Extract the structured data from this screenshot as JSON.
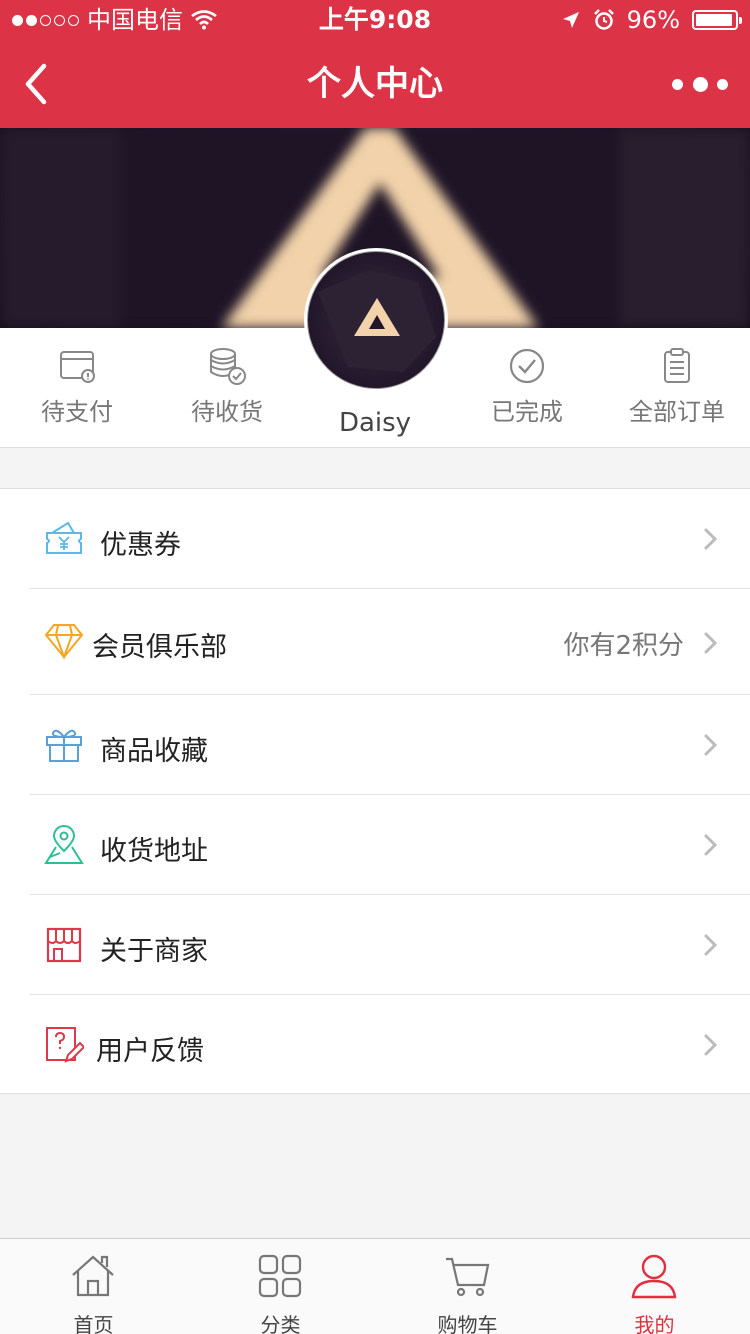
{
  "status_bar": {
    "carrier": "中国电信",
    "time": "上午9:08",
    "battery": "96%",
    "battery_level": 0.96
  },
  "nav": {
    "title": "个人中心",
    "back_icon": "chevron-left-icon",
    "more_icon": "ellipsis-icon"
  },
  "profile": {
    "username": "Daisy"
  },
  "orders": [
    {
      "label": "待支付",
      "icon": "wallet-icon"
    },
    {
      "label": "待收货",
      "icon": "coins-check-icon"
    },
    {
      "label": "已完成",
      "icon": "check-circle-icon"
    },
    {
      "label": "全部订单",
      "icon": "clipboard-icon"
    }
  ],
  "menu": [
    {
      "label": "优惠券",
      "icon": "coupon-icon",
      "extra": ""
    },
    {
      "label": "会员俱乐部",
      "icon": "diamond-icon",
      "extra": "你有2积分"
    },
    {
      "label": "商品收藏",
      "icon": "gift-icon",
      "extra": ""
    },
    {
      "label": "收货地址",
      "icon": "map-pin-icon",
      "extra": ""
    },
    {
      "label": "关于商家",
      "icon": "store-icon",
      "extra": ""
    },
    {
      "label": "用户反馈",
      "icon": "feedback-icon",
      "extra": ""
    }
  ],
  "tabbar": [
    {
      "label": "首页",
      "icon": "home-icon",
      "active": false
    },
    {
      "label": "分类",
      "icon": "grid-icon",
      "active": false
    },
    {
      "label": "购物车",
      "icon": "cart-icon",
      "active": false
    },
    {
      "label": "我的",
      "icon": "user-icon",
      "active": true
    }
  ],
  "colors": {
    "brand": "#dc3346",
    "active_tab": "#e0303f"
  }
}
